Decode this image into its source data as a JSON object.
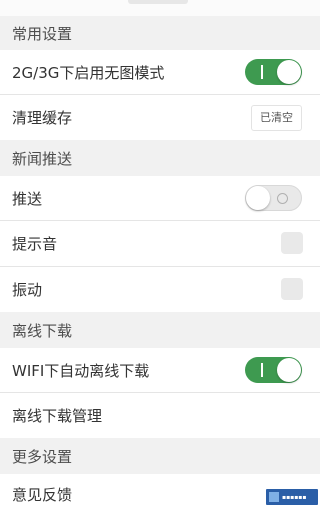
{
  "sections": {
    "common": "常用设置",
    "news_push": "新闻推送",
    "offline": "离线下载",
    "more": "更多设置"
  },
  "rows": {
    "no_image_mode": {
      "label": "2G/3G下启用无图模式",
      "enabled": true
    },
    "clear_cache": {
      "label": "清理缓存",
      "button": "已清空"
    },
    "push": {
      "label": "推送",
      "enabled": false
    },
    "sound": {
      "label": "提示音",
      "checked": false
    },
    "vibrate": {
      "label": "振动",
      "checked": false
    },
    "wifi_offline": {
      "label": "WIFI下自动离线下载",
      "enabled": true
    },
    "offline_manage": {
      "label": "离线下载管理"
    },
    "feedback": {
      "label": "意见反馈"
    }
  },
  "colors": {
    "toggle_on": "#3e9a50",
    "toggle_off": "#e9e9e9",
    "background": "#f1f1f1"
  }
}
